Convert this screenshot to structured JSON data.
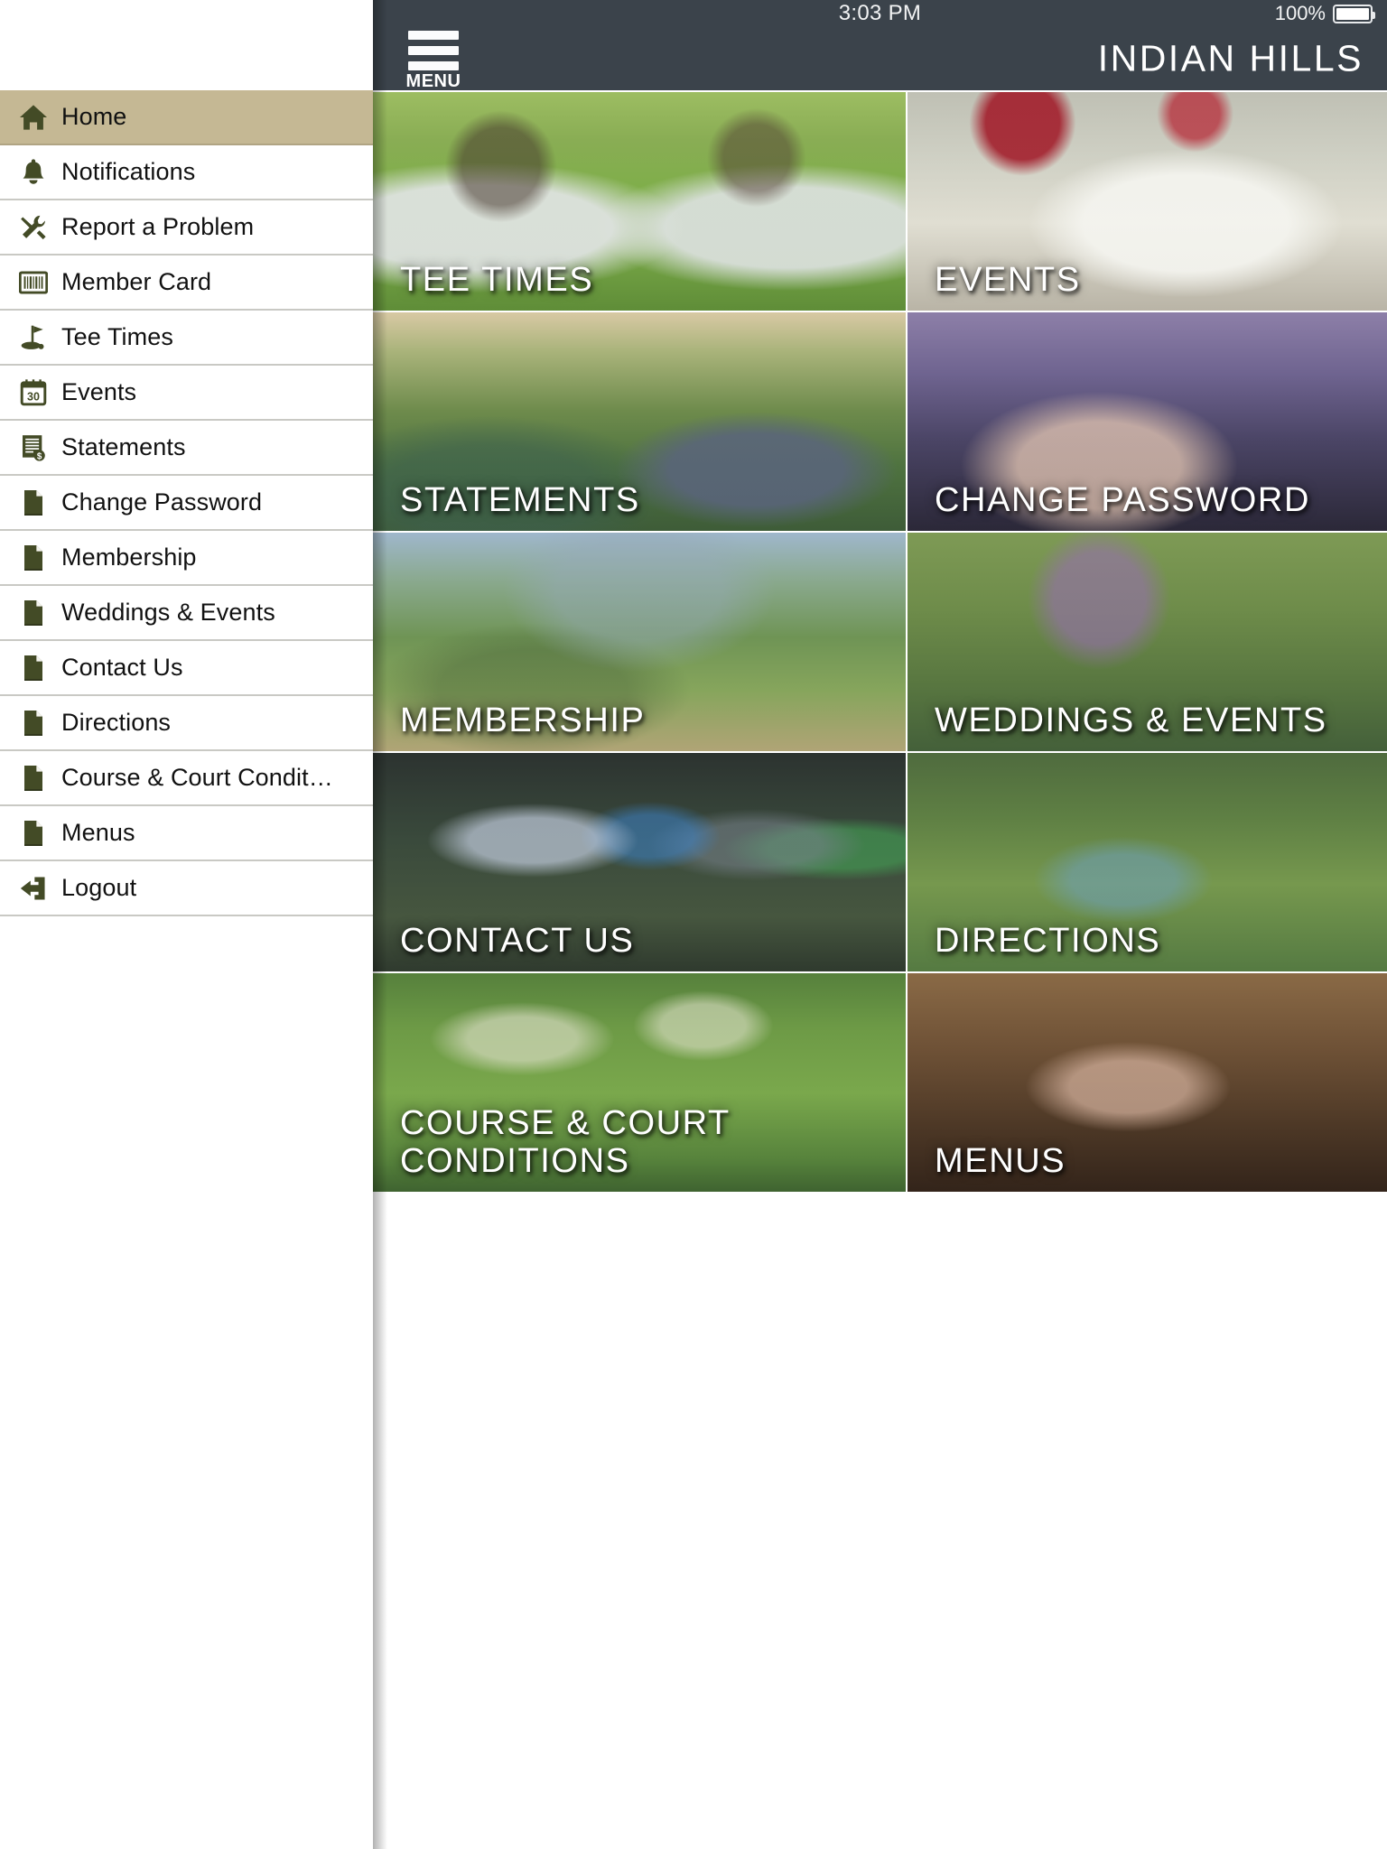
{
  "statusbar": {
    "time": "3:03 PM",
    "battery_percent": "100%",
    "battery_icon": "battery-full-icon"
  },
  "navbar": {
    "menu_button_label": "MENU",
    "menu_icon": "hamburger-menu-icon",
    "title": "INDIAN HILLS"
  },
  "sidebar": {
    "active_item": "Home",
    "active_bg": "#c5b894",
    "icon_color": "#434b26",
    "items": [
      {
        "label": "Home",
        "icon": "home-icon",
        "active": true
      },
      {
        "label": "Notifications",
        "icon": "bell-icon",
        "active": false
      },
      {
        "label": "Report a Problem",
        "icon": "tools-icon",
        "active": false
      },
      {
        "label": "Member Card",
        "icon": "barcode-card-icon",
        "active": false
      },
      {
        "label": "Tee Times",
        "icon": "golf-flag-icon",
        "active": false
      },
      {
        "label": "Events",
        "icon": "calendar-30-icon",
        "active": false
      },
      {
        "label": "Statements",
        "icon": "invoice-dollar-icon",
        "active": false
      },
      {
        "label": "Change Password",
        "icon": "document-icon",
        "active": false
      },
      {
        "label": "Membership",
        "icon": "document-icon",
        "active": false
      },
      {
        "label": "Weddings & Events",
        "icon": "document-icon",
        "active": false
      },
      {
        "label": "Contact Us",
        "icon": "document-icon",
        "active": false
      },
      {
        "label": "Directions",
        "icon": "document-icon",
        "active": false
      },
      {
        "label": "Course & Court Condit…",
        "icon": "document-icon",
        "active": false
      },
      {
        "label": "Menus",
        "icon": "document-icon",
        "active": false
      },
      {
        "label": "Logout",
        "icon": "logout-arrow-icon",
        "active": false
      }
    ]
  },
  "main": {
    "tiles": [
      {
        "label": "TEE TIMES",
        "photo": "golf-carts-on-course-photo",
        "span": 2
      },
      {
        "label": "EVENTS",
        "photo": "table-setting-flowers-photo",
        "span": 2
      },
      {
        "label": "STATEMENTS",
        "photo": "aerial-clubhouse-photo",
        "span": 2
      },
      {
        "label": "CHANGE PASSWORD",
        "photo": "hands-on-laptop-photo",
        "span": 2
      },
      {
        "label": "MEMBERSHIP",
        "photo": "clubhouse-lawn-golfers-photo",
        "span": 2
      },
      {
        "label": "WEDDINGS & EVENTS",
        "photo": "garden-flowers-photo",
        "span": 2
      },
      {
        "label": "CONTACT US",
        "photo": "junior-golfers-group-photo",
        "span": 2
      },
      {
        "label": "DIRECTIONS",
        "photo": "aerial-pools-course-photo",
        "span": 2
      },
      {
        "label": "COURSE & COURT\nCONDITIONS",
        "photo": "golfer-swinging-photo",
        "span": 2
      },
      {
        "label": "MENUS",
        "photo": "diners-with-wine-photo",
        "span": 2
      }
    ]
  },
  "colors": {
    "navbar_bg": "#3b434b",
    "sidebar_active": "#c5b894",
    "sidebar_icon": "#434b26",
    "tile_text": "#ffffff"
  }
}
